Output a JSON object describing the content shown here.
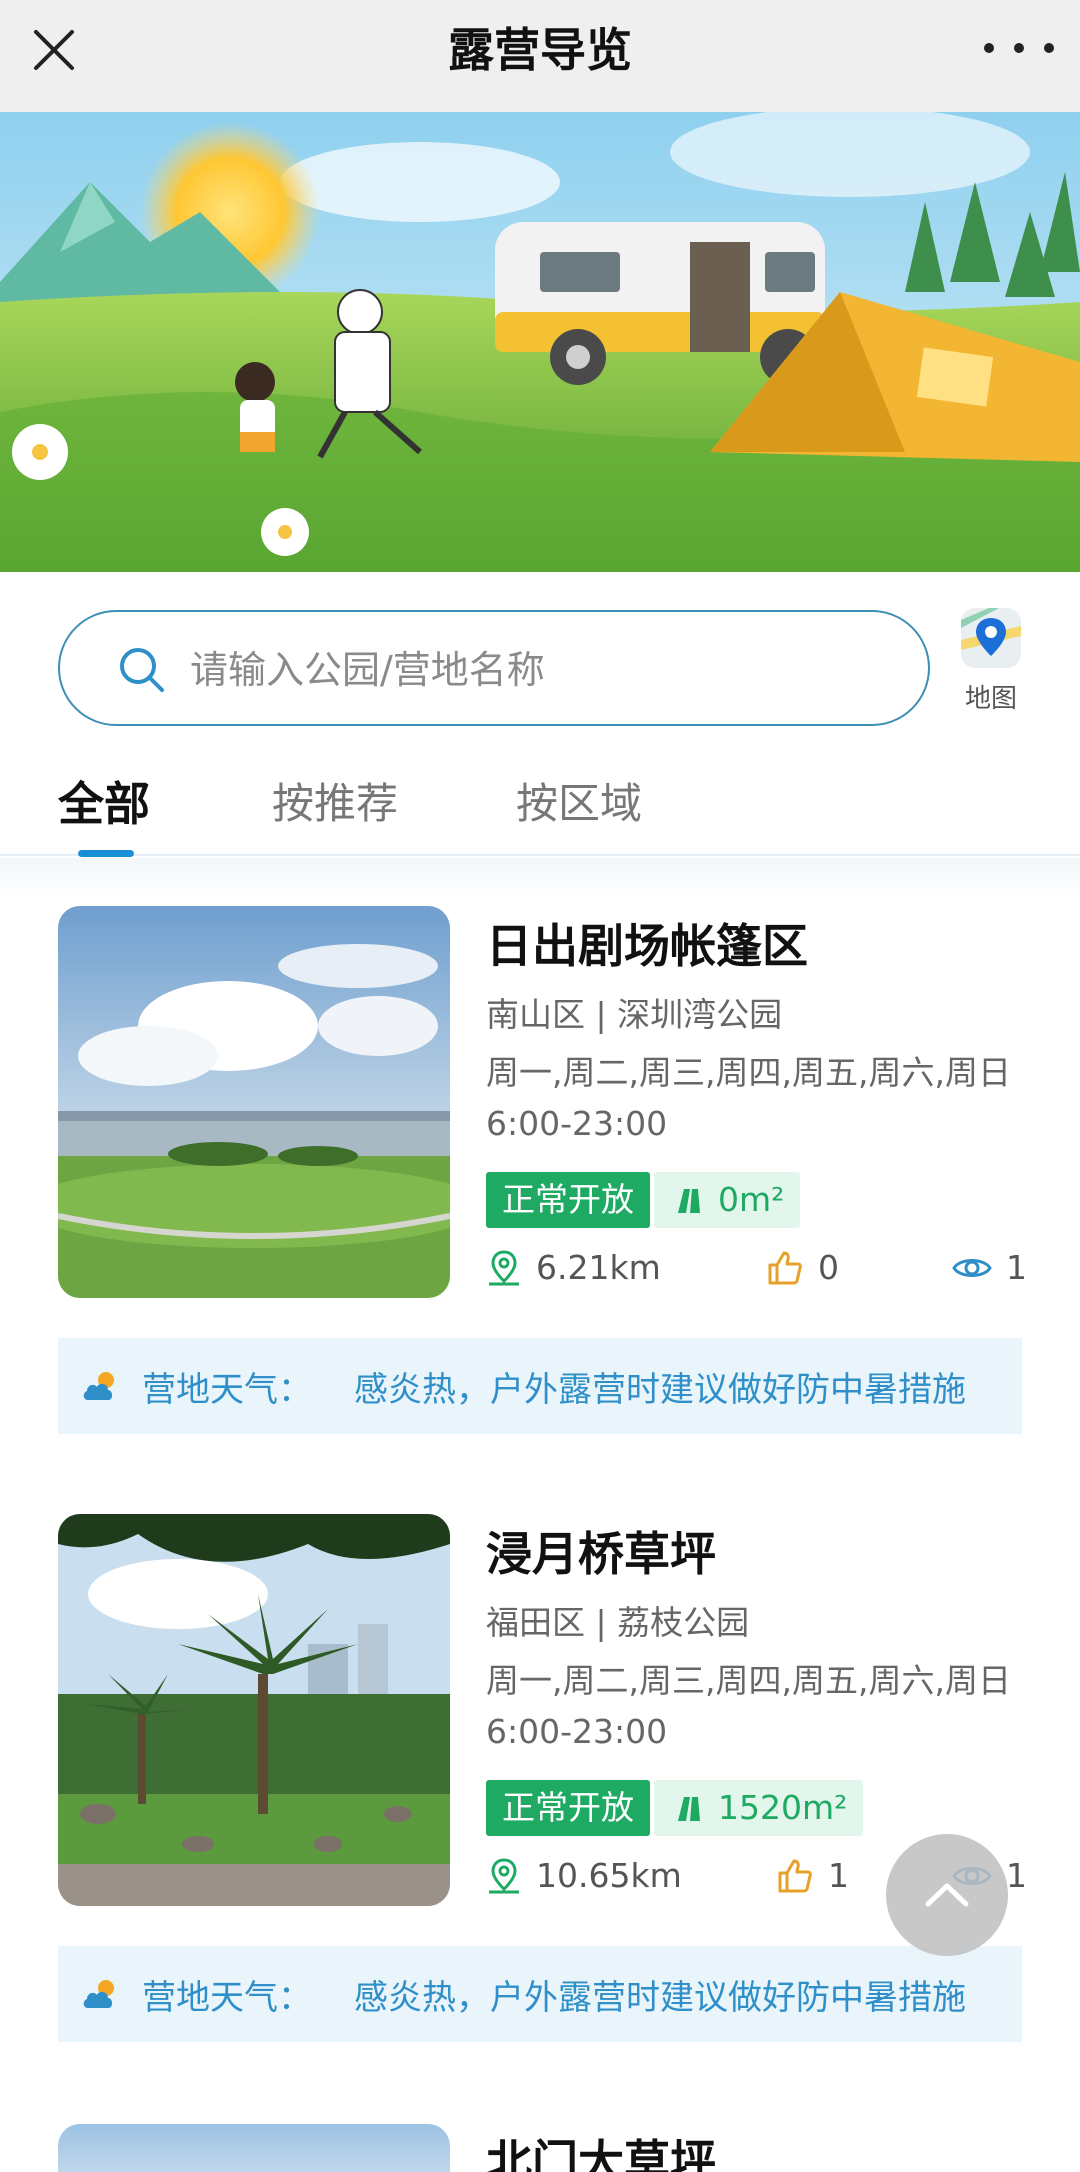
{
  "header": {
    "title": "露营导览",
    "close_icon": "close-icon",
    "more_icon": "more-dots-icon"
  },
  "search": {
    "placeholder": "请输入公园/营地名称",
    "map_label": "地图"
  },
  "tabs": [
    {
      "label": "全部",
      "active": true
    },
    {
      "label": "按推荐",
      "active": false
    },
    {
      "label": "按区域",
      "active": false
    }
  ],
  "cards": [
    {
      "title": "日出剧场帐篷区",
      "location": "南山区 | 深圳湾公园",
      "days": "周一,周二,周三,周四,周五,周六,周日",
      "hours": "6:00-23:00",
      "status": "正常开放",
      "area": "0m²",
      "distance": "6.21km",
      "likes": "0",
      "views": "1",
      "weather_label": "营地天气：",
      "weather_text": "感炎热，户外露营时建议做好防中暑措施"
    },
    {
      "title": "浸月桥草坪",
      "location": "福田区 | 荔枝公园",
      "days": "周一,周二,周三,周四,周五,周六,周日",
      "hours": "6:00-23:00",
      "status": "正常开放",
      "area": "1520m²",
      "distance": "10.65km",
      "likes": "1",
      "views": "1",
      "weather_label": "营地天气：",
      "weather_text": "感炎热，户外露营时建议做好防中暑措施"
    },
    {
      "title": "北门大草坪"
    }
  ],
  "colors": {
    "accent": "#1b8fd6",
    "open_green": "#1faa63",
    "weather_blue": "#2f8fc8"
  }
}
